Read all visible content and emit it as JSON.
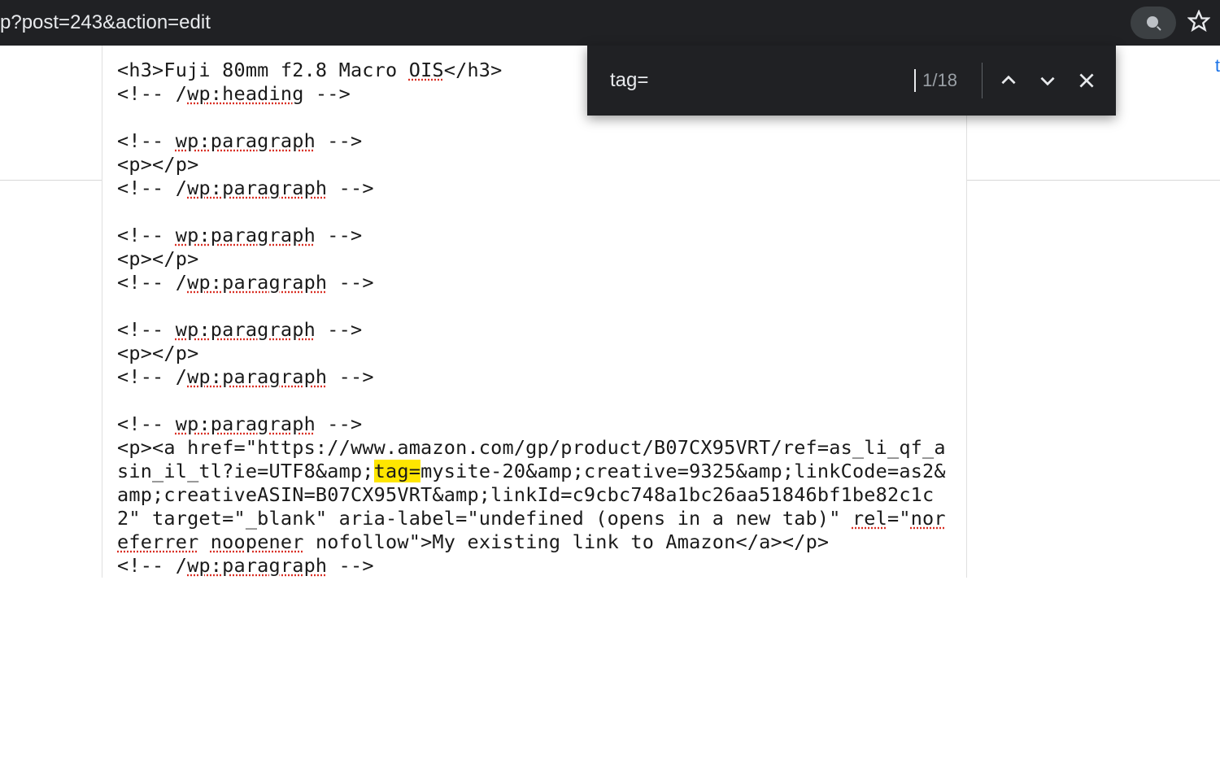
{
  "url_fragment": "p?post=243&action=edit",
  "find": {
    "query": "tag=",
    "count": "1/18"
  },
  "blue_edge_text": "t",
  "code": {
    "l01_a": "<h3>Fuji 80mm f2.8 Macro ",
    "l01_b": "OIS",
    "l01_c": "</h3>",
    "l02_a": "<!-- /",
    "l02_b": "wp:heading",
    "l02_c": " -->",
    "l03_a": "<!-- ",
    "l03_b": "wp:paragraph",
    "l03_c": " -->",
    "l04": "<p></p>",
    "l05_a": "<!-- /",
    "l05_b": "wp:paragraph",
    "l05_c": " -->",
    "l06_a": "<!-- ",
    "l06_b": "wp:paragraph",
    "l06_c": " -->",
    "l07": "<p></p>",
    "l08_a": "<!-- /",
    "l08_b": "wp:paragraph",
    "l08_c": " -->",
    "l09_a": "<!-- ",
    "l09_b": "wp:paragraph",
    "l09_c": " -->",
    "l10": "<p></p>",
    "l11_a": "<!-- /",
    "l11_b": "wp:paragraph",
    "l11_c": " -->",
    "l12_a": "<!-- ",
    "l12_b": "wp:paragraph",
    "l12_c": " -->",
    "l13": "<p><a href=\"https://www.amazon.com/gp/product/B07CX95VRT/ref=as_li_qf_asin_il_tl?ie=UTF8&amp;",
    "l13_hl": "tag=",
    "l13_post": "mysite-20&amp;creative=9325&amp;linkCode=as2&amp;creativeASIN=B07CX95VRT&amp;linkId=c9cbc748a1bc26aa51846bf1be82c1c2\" target=\"_blank\" aria-label=\"undefined (opens in a new tab)\" ",
    "l13_rel": "rel",
    "l13_eq": "=\"",
    "l13_nrf": "noreferrer",
    "l13_sp": " ",
    "l13_nop": "noopener",
    "l13_nf": " nofollow\">My existing link to Amazon</a></p>",
    "l14_a": "<!-- /",
    "l14_b": "wp:paragraph",
    "l14_c": " -->"
  }
}
